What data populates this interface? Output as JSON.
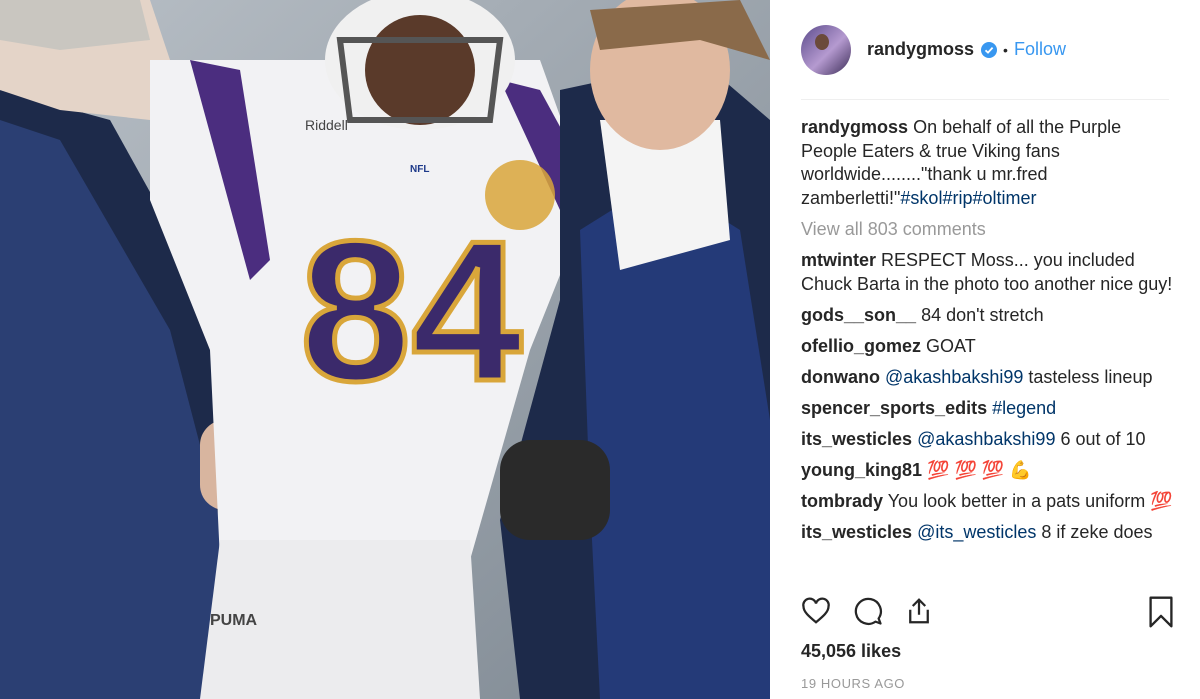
{
  "post": {
    "username": "randygmoss",
    "follow_label": "Follow",
    "caption_username": "randygmoss",
    "caption_text": "On behalf of all the Purple People Eaters & true Viking fans worldwide........\"thank u mr.fred zamberletti!\"",
    "caption_tags": "#skol#rip#oltimer",
    "view_all": "View all 803 comments",
    "likes": "45,056 likes",
    "time": "19 HOURS AGO"
  },
  "comments": [
    {
      "user": "mtwinter",
      "mention": "",
      "text": "RESPECT Moss... you included Chuck Barta in the photo too another nice guy!"
    },
    {
      "user": "gods__son__",
      "mention": "",
      "text": "84 don't stretch"
    },
    {
      "user": "ofellio_gomez",
      "mention": "",
      "text": "GOAT"
    },
    {
      "user": "donwano",
      "mention": "@akashbakshi99",
      "text": "tasteless lineup"
    },
    {
      "user": "spencer_sports_edits",
      "mention": "#legend",
      "text": ""
    },
    {
      "user": "its_westicles",
      "mention": "@akashbakshi99",
      "text": "6 out of 10"
    },
    {
      "user": "young_king81",
      "mention": "",
      "text": "💯 💯 💯 💪"
    },
    {
      "user": "tombrady",
      "mention": "",
      "text": "You look better in a pats uniform 💯"
    },
    {
      "user": "its_westicles",
      "mention": "@its_westicles",
      "text": "8 if zeke does"
    }
  ],
  "photo": {
    "jersey_number": "84",
    "brand_1": "Riddell",
    "brand_2": "PUMA",
    "patch": "NFL"
  },
  "colors": {
    "accent": "#3897f0",
    "purple": "#3b2a6b",
    "gold": "#d9a63a"
  }
}
